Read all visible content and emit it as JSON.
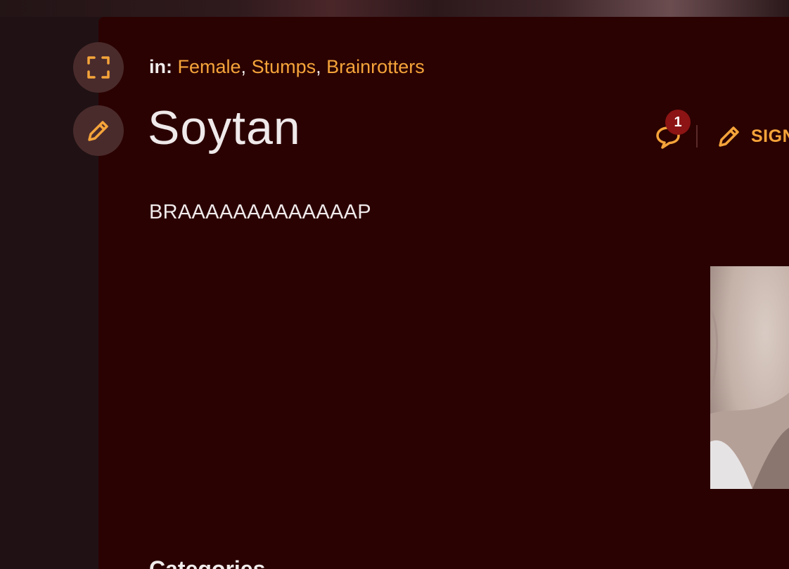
{
  "breadcrumb": {
    "prefix": "in:",
    "categories": [
      "Female",
      "Stumps",
      "Brainrotters"
    ]
  },
  "page": {
    "title": "Soytan",
    "description": "BRAAAAAAAAAAAAAP"
  },
  "actions": {
    "comment_count": "1",
    "sign_label": "SIGN"
  },
  "sections": {
    "categories_heading": "Categories"
  },
  "icons": {
    "fullscreen": "fullscreen-icon",
    "edit": "pencil-icon",
    "comments": "speech-bubble-icon",
    "sign": "pencil-icon"
  },
  "colors": {
    "accent": "#f5a43a",
    "panel": "#2b0202",
    "badge": "#8c1414"
  }
}
